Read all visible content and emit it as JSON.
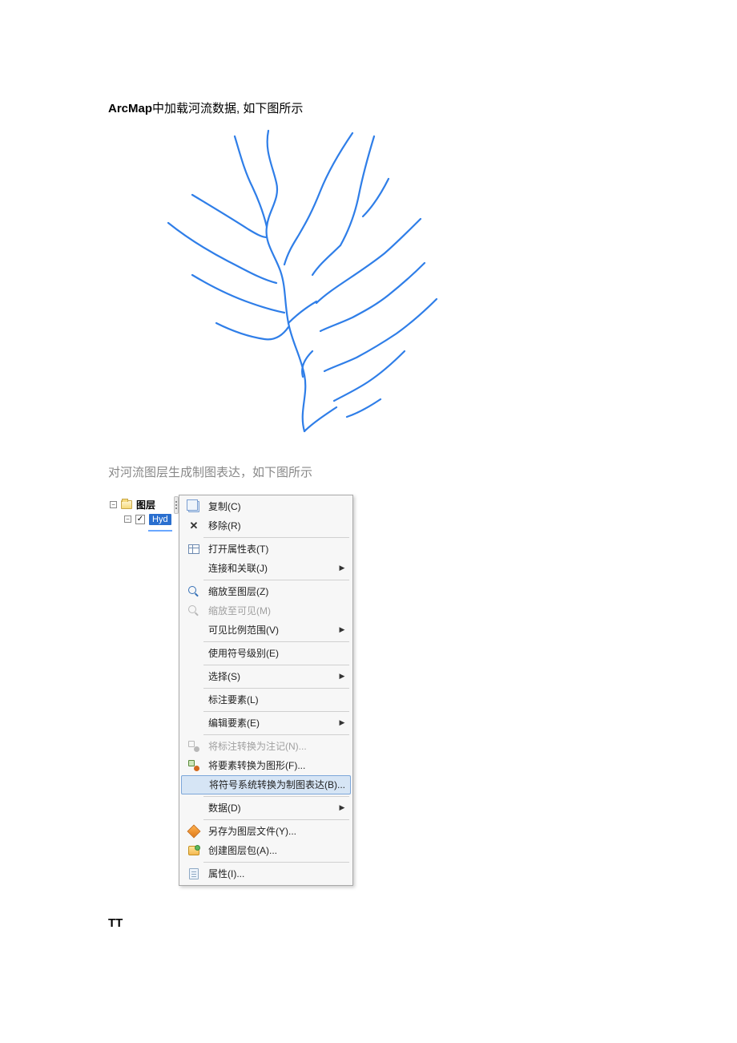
{
  "titleBold": "ArcMap",
  "titleRest": "中加载河流数据, 如下图所示",
  "subtitle": "对河流图层生成制图表达，如下图所示",
  "toc": {
    "root": "图层",
    "layerName": "Hyd"
  },
  "menu": {
    "copy": "复制(C)",
    "remove": "移除(R)",
    "openTable": "打开属性表(T)",
    "joinRelate": "连接和关联(J)",
    "zoomLayer": "缩放至图层(Z)",
    "zoomVisible": "缩放至可见(M)",
    "visibleScale": "可见比例范围(V)",
    "useSymbolLevel": "使用符号级别(E)",
    "selection": "选择(S)",
    "labelFeatures": "标注要素(L)",
    "editFeatures": "编辑要素(E)",
    "convertLabel": "将标注转换为注记(N)...",
    "convertGraphic": "将要素转换为图形(F)...",
    "convertRep": "将符号系统转换为制图表达(B)...",
    "data": "数据(D)",
    "saveLayerFile": "另存为图层文件(Y)...",
    "createPkg": "创建图层包(A)...",
    "properties": "属性(I)..."
  },
  "footer": "TT"
}
